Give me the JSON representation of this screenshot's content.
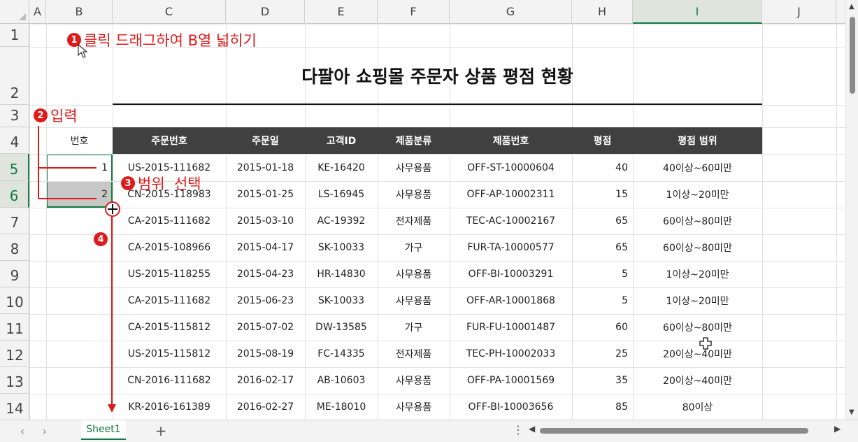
{
  "columns": [
    {
      "label": "A",
      "selected": false
    },
    {
      "label": "B",
      "selected": false
    },
    {
      "label": "C",
      "selected": false
    },
    {
      "label": "D",
      "selected": false
    },
    {
      "label": "E",
      "selected": false
    },
    {
      "label": "F",
      "selected": false
    },
    {
      "label": "G",
      "selected": false
    },
    {
      "label": "H",
      "selected": false
    },
    {
      "label": "I",
      "selected": true
    },
    {
      "label": "J",
      "selected": false
    }
  ],
  "rows": [
    {
      "label": "1",
      "selected": false
    },
    {
      "label": "2",
      "selected": false
    },
    {
      "label": "3",
      "selected": false
    },
    {
      "label": "4",
      "selected": false
    },
    {
      "label": "5",
      "selected": true
    },
    {
      "label": "6",
      "selected": true
    },
    {
      "label": "7",
      "selected": false
    },
    {
      "label": "8",
      "selected": false
    },
    {
      "label": "9",
      "selected": false
    },
    {
      "label": "10",
      "selected": false
    },
    {
      "label": "11",
      "selected": false
    },
    {
      "label": "12",
      "selected": false
    },
    {
      "label": "13",
      "selected": false
    },
    {
      "label": "14",
      "selected": false
    }
  ],
  "sheet": {
    "title": "다팔아 쇼핑몰 주문자 상품 평점 현황",
    "number_header": "번호",
    "numbers": [
      "1",
      "2"
    ],
    "headers": [
      "주문번호",
      "주문일",
      "고객ID",
      "제품분류",
      "제품번호",
      "평점",
      "평점 범위"
    ],
    "data": [
      [
        "US-2015-111682",
        "2015-01-18",
        "KE-16420",
        "사무용품",
        "OFF-ST-10000604",
        "40",
        "40이상~60미만"
      ],
      [
        "CN-2015-118983",
        "2015-01-25",
        "LS-16945",
        "사무용품",
        "OFF-AP-10002311",
        "15",
        "1이상~20미만"
      ],
      [
        "CA-2015-111682",
        "2015-03-10",
        "AC-19392",
        "전자제품",
        "TEC-AC-10002167",
        "65",
        "60이상~80미만"
      ],
      [
        "CA-2015-108966",
        "2015-04-17",
        "SK-10033",
        "가구",
        "FUR-TA-10000577",
        "65",
        "60이상~80미만"
      ],
      [
        "US-2015-118255",
        "2015-04-23",
        "HR-14830",
        "사무용품",
        "OFF-BI-10003291",
        "5",
        "1이상~20미만"
      ],
      [
        "CA-2015-111682",
        "2015-06-23",
        "SK-10033",
        "사무용품",
        "OFF-AR-10001868",
        "5",
        "1이상~20미만"
      ],
      [
        "CA-2015-115812",
        "2015-07-02",
        "DW-13585",
        "가구",
        "FUR-FU-10001487",
        "60",
        "60이상~80미만"
      ],
      [
        "US-2015-115812",
        "2015-08-19",
        "FC-14335",
        "전자제품",
        "TEC-PH-10002033",
        "25",
        "20이상~40미만"
      ],
      [
        "CN-2016-111682",
        "2016-02-17",
        "AB-10603",
        "사무용품",
        "OFF-PA-10001569",
        "35",
        "20이상~40미만"
      ],
      [
        "KR-2016-161389",
        "2016-02-27",
        "ME-18010",
        "사무용품",
        "OFF-BI-10003656",
        "85",
        "80이상"
      ]
    ]
  },
  "annotations": {
    "step1": {
      "badge": "1",
      "text": "클릭 드래그하여 B열 넓히기"
    },
    "step2": {
      "badge": "2",
      "text": "입력"
    },
    "step3": {
      "badge": "3",
      "text": "범위  선택"
    },
    "step4": {
      "badge": "4"
    },
    "accent_color": "#e01a1a"
  },
  "footer": {
    "sheet_tab": "Sheet1",
    "add_sheet": "+",
    "more": "⋮",
    "prev": "‹",
    "next": "›"
  },
  "colors": {
    "header_band": "#404040",
    "selection": "#107c41"
  }
}
